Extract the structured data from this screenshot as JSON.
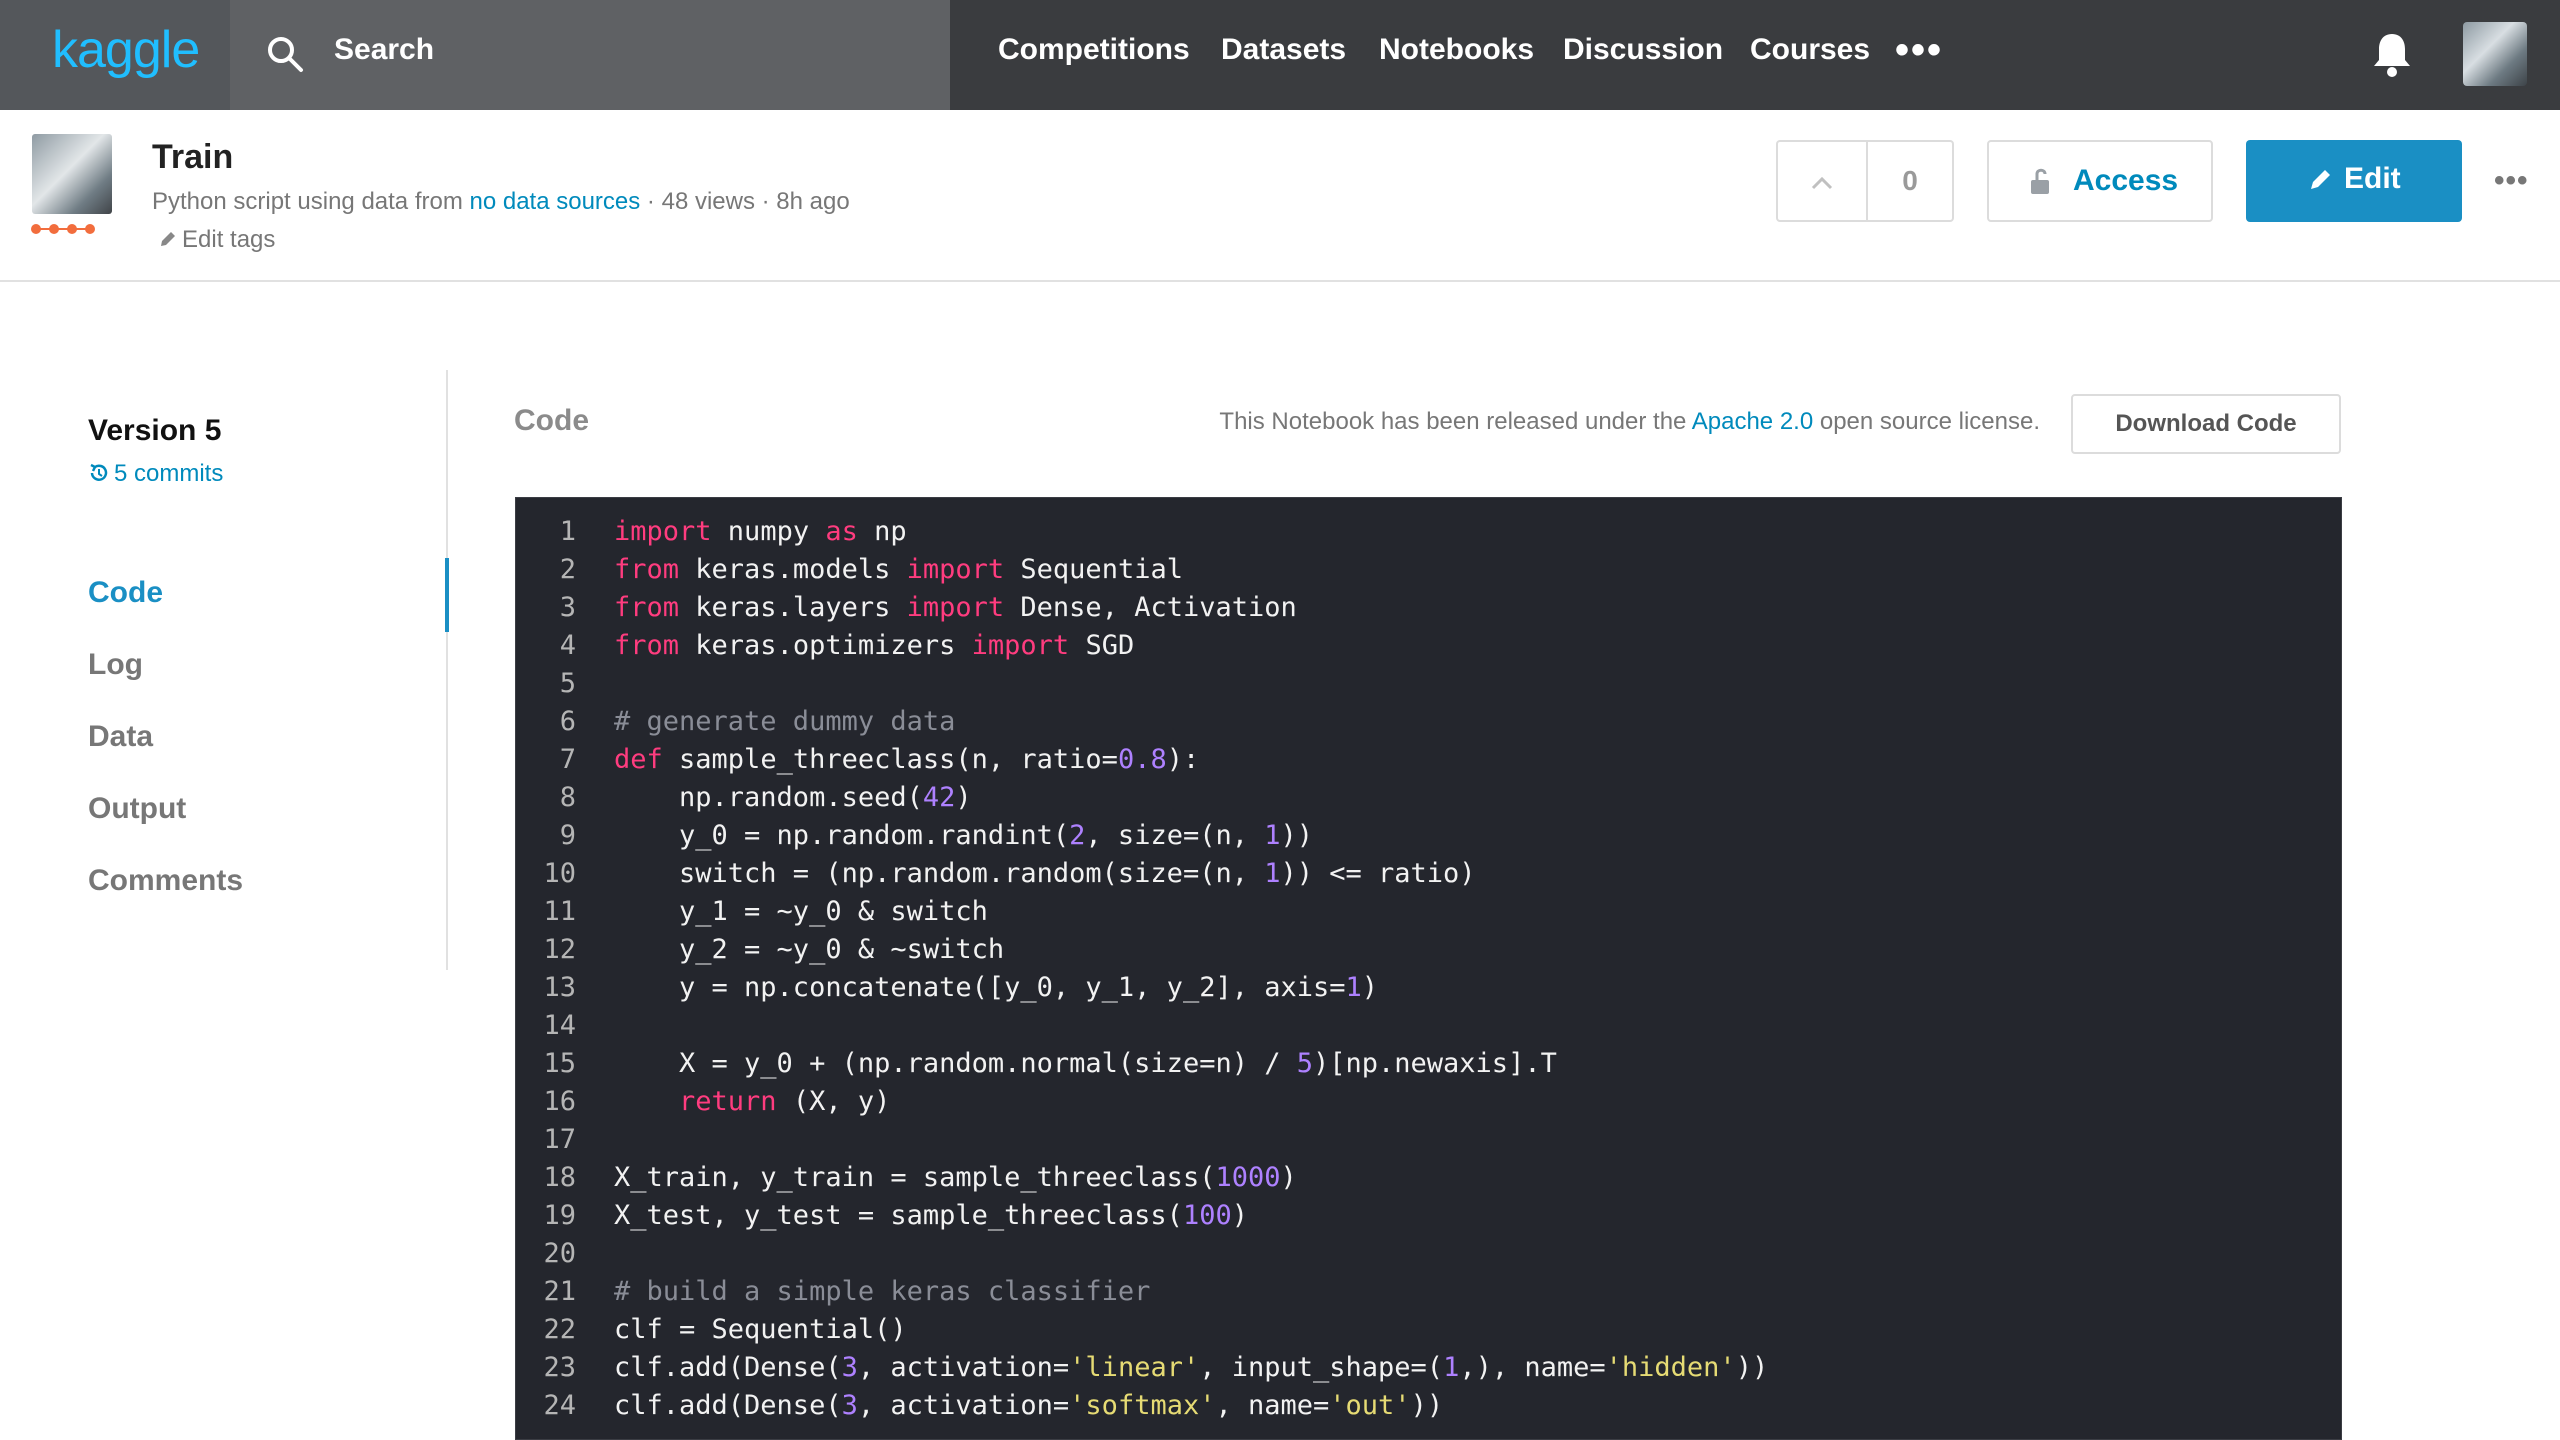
{
  "nav": {
    "logo": "kaggle",
    "search_label": "Search",
    "links": [
      "Competitions",
      "Datasets",
      "Notebooks",
      "Discussion",
      "Courses"
    ],
    "more": "•••"
  },
  "header": {
    "title": "Train",
    "meta_prefix": "Python script using data from ",
    "meta_link": "no data sources",
    "meta_suffix": " · 48 views · 8h ago",
    "edit_tags": "Edit tags",
    "vote_count": "0",
    "access_label": "Access",
    "edit_label": "Edit",
    "more": "•••"
  },
  "sidebar": {
    "version": "Version 5",
    "commits": "5 commits",
    "items": [
      "Code",
      "Log",
      "Data",
      "Output",
      "Comments"
    ],
    "active": "Code"
  },
  "content": {
    "heading": "Code",
    "license_prefix": "This Notebook has been released under the ",
    "license_link": "Apache 2.0",
    "license_suffix": " open source license.",
    "download_label": "Download Code"
  },
  "colors": {
    "nav_bg": "#3a3c3f",
    "accent": "#1a8fc4",
    "link": "#008abc",
    "code_bg": "#24262d",
    "keyword": "#ff3c7f",
    "number": "#ae81ff",
    "string": "#e6db74",
    "comment": "#8a8d97"
  },
  "code_lines": [
    [
      [
        "kw",
        "import"
      ],
      [
        "t",
        " numpy "
      ],
      [
        "kw",
        "as"
      ],
      [
        "t",
        " np"
      ]
    ],
    [
      [
        "kw",
        "from"
      ],
      [
        "t",
        " keras.models "
      ],
      [
        "kw",
        "import"
      ],
      [
        "t",
        " Sequential"
      ]
    ],
    [
      [
        "kw",
        "from"
      ],
      [
        "t",
        " keras.layers "
      ],
      [
        "kw",
        "import"
      ],
      [
        "t",
        " Dense, Activation"
      ]
    ],
    [
      [
        "kw",
        "from"
      ],
      [
        "t",
        " keras.optimizers "
      ],
      [
        "kw",
        "import"
      ],
      [
        "t",
        " SGD"
      ]
    ],
    [],
    [
      [
        "cmt",
        "# generate dummy data"
      ]
    ],
    [
      [
        "kw",
        "def"
      ],
      [
        "t",
        " sample_threeclass(n, ratio="
      ],
      [
        "num",
        "0.8"
      ],
      [
        "t",
        "):"
      ]
    ],
    [
      [
        "t",
        "    np.random.seed("
      ],
      [
        "num",
        "42"
      ],
      [
        "t",
        ")"
      ]
    ],
    [
      [
        "t",
        "    y_0 = np.random.randint("
      ],
      [
        "num",
        "2"
      ],
      [
        "t",
        ", size=(n, "
      ],
      [
        "num",
        "1"
      ],
      [
        "t",
        "))"
      ]
    ],
    [
      [
        "t",
        "    switch = (np.random.random(size=(n, "
      ],
      [
        "num",
        "1"
      ],
      [
        "t",
        ")) <= ratio)"
      ]
    ],
    [
      [
        "t",
        "    y_1 = ~y_0 & switch"
      ]
    ],
    [
      [
        "t",
        "    y_2 = ~y_0 & ~switch"
      ]
    ],
    [
      [
        "t",
        "    y = np.concatenate([y_0, y_1, y_2], axis="
      ],
      [
        "num",
        "1"
      ],
      [
        "t",
        ")"
      ]
    ],
    [],
    [
      [
        "t",
        "    X = y_0 + (np.random.normal(size=n) / "
      ],
      [
        "num",
        "5"
      ],
      [
        "t",
        ")[np.newaxis].T"
      ]
    ],
    [
      [
        "t",
        "    "
      ],
      [
        "kw",
        "return"
      ],
      [
        "t",
        " (X, y)"
      ]
    ],
    [],
    [
      [
        "t",
        "X_train, y_train = sample_threeclass("
      ],
      [
        "num",
        "1000"
      ],
      [
        "t",
        ")"
      ]
    ],
    [
      [
        "t",
        "X_test, y_test = sample_threeclass("
      ],
      [
        "num",
        "100"
      ],
      [
        "t",
        ")"
      ]
    ],
    [],
    [
      [
        "cmt",
        "# build a simple keras classifier"
      ]
    ],
    [
      [
        "t",
        "clf = Sequential()"
      ]
    ],
    [
      [
        "t",
        "clf.add(Dense("
      ],
      [
        "num",
        "3"
      ],
      [
        "t",
        ", activation="
      ],
      [
        "str",
        "'linear'"
      ],
      [
        "t",
        ", input_shape=("
      ],
      [
        "num",
        "1"
      ],
      [
        "t",
        ",), name="
      ],
      [
        "str",
        "'hidden'"
      ],
      [
        "t",
        "))"
      ]
    ],
    [
      [
        "t",
        "clf.add(Dense("
      ],
      [
        "num",
        "3"
      ],
      [
        "t",
        ", activation="
      ],
      [
        "str",
        "'softmax'"
      ],
      [
        "t",
        ", name="
      ],
      [
        "str",
        "'out'"
      ],
      [
        "t",
        "))"
      ]
    ]
  ]
}
